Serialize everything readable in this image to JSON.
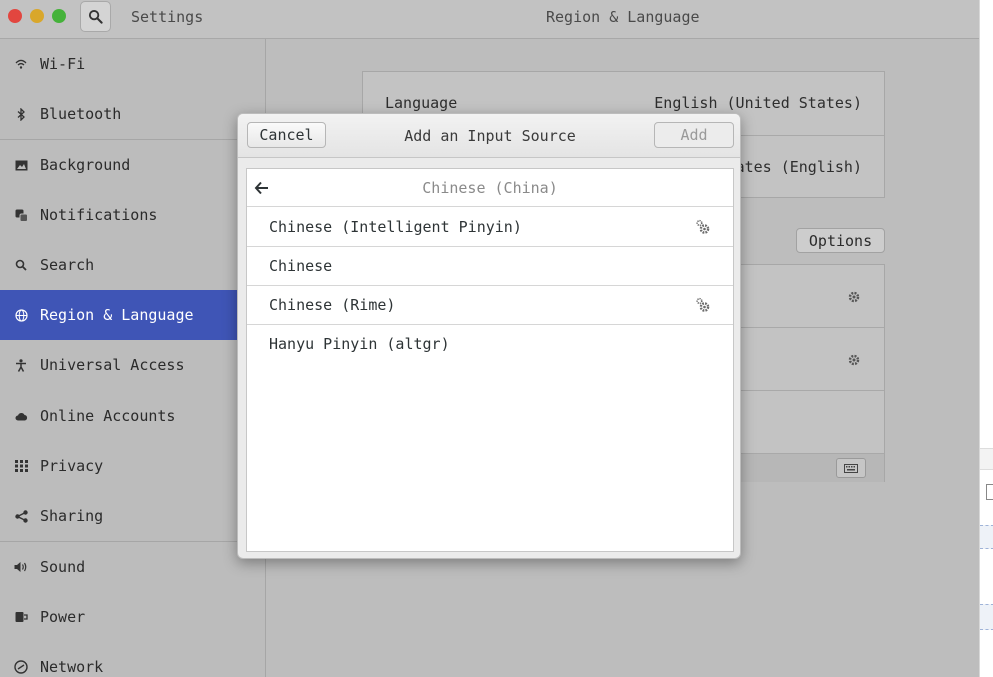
{
  "window": {
    "app_title": "Settings",
    "panel_title": "Region & Language"
  },
  "sidebar": {
    "items": [
      {
        "label": "Wi-Fi",
        "icon": "wifi-icon"
      },
      {
        "label": "Bluetooth",
        "icon": "bluetooth-icon"
      },
      {
        "label": "Background",
        "icon": "image-icon"
      },
      {
        "label": "Notifications",
        "icon": "notifications-icon"
      },
      {
        "label": "Search",
        "icon": "search-icon"
      },
      {
        "label": "Region & Language",
        "icon": "globe-icon",
        "active": true
      },
      {
        "label": "Universal Access",
        "icon": "accessibility-icon"
      },
      {
        "label": "Online Accounts",
        "icon": "cloud-icon"
      },
      {
        "label": "Privacy",
        "icon": "privacy-icon"
      },
      {
        "label": "Sharing",
        "icon": "share-icon"
      },
      {
        "label": "Sound",
        "icon": "speaker-icon"
      },
      {
        "label": "Power",
        "icon": "power-icon"
      },
      {
        "label": "Network",
        "icon": "network-icon"
      }
    ]
  },
  "region": {
    "language_label": "Language",
    "language_value": "English (United States)",
    "formats_value_partial": "ates (English)",
    "options_label": "Options"
  },
  "dialog": {
    "title": "Add an Input Source",
    "cancel_label": "Cancel",
    "add_label": "Add",
    "group_title": "Chinese (China)",
    "items": [
      {
        "label": "Chinese (Intelligent Pinyin)",
        "has_settings": true
      },
      {
        "label": "Chinese",
        "has_settings": false
      },
      {
        "label": "Chinese (Rime)",
        "has_settings": true
      },
      {
        "label": "Hanyu Pinyin (altgr)",
        "has_settings": false
      }
    ]
  },
  "colors": {
    "accent": "#3f55b6",
    "close": "#e2463f",
    "minimize": "#d9a72b",
    "maximize": "#45b23a"
  }
}
